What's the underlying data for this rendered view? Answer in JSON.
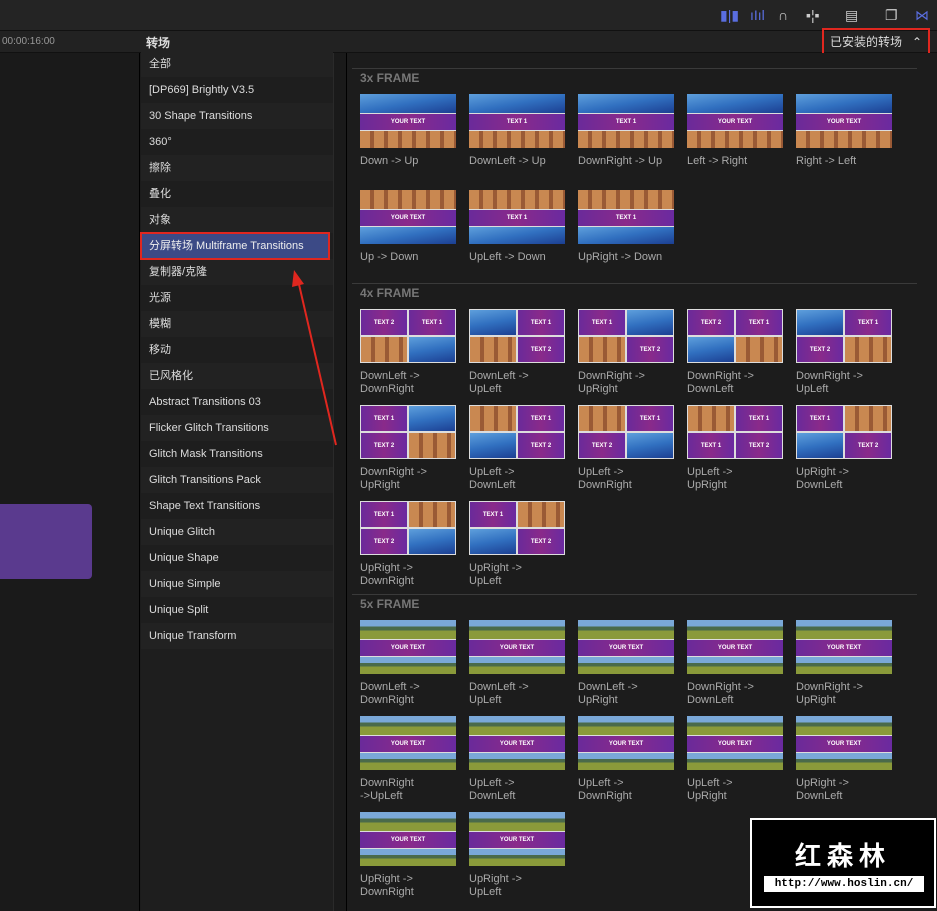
{
  "topbar": {
    "icons": [
      "clip-appearance-icon",
      "audio-waveform-icon",
      "headphones-icon",
      "snapping-icon",
      "filmstrip-icon",
      "window-icon",
      "transitions-browser-icon"
    ]
  },
  "timeline": {
    "timecode": "00:00:16:00"
  },
  "sidebar": {
    "title": "转场",
    "items": [
      "全部",
      "[DP669] Brightly V3.5",
      "30 Shape Transitions",
      "360°",
      "擦除",
      "叠化",
      "对象",
      "分屏转场 Multiframe Transitions",
      "复制器/克隆",
      "光源",
      "模糊",
      "移动",
      "已风格化",
      "Abstract Transitions 03",
      "Flicker Glitch Transitions",
      "Glitch Mask Transitions",
      "Glitch Transitions Pack",
      "Shape Text Transitions",
      "Unique Glitch",
      "Unique Shape",
      "Unique Simple",
      "Unique Split",
      "Unique Transform"
    ],
    "selected": 7
  },
  "filter": {
    "label": "已安装的转场",
    "icon": "chevron-updown-icon"
  },
  "sections": [
    {
      "title": "3x FRAME",
      "layout": "3x",
      "items": [
        {
          "label": "Down -> Up",
          "text": "YOUR TEXT",
          "v": "down"
        },
        {
          "label": "DownLeft -> Up",
          "text": "TEXT 1",
          "v": "dl"
        },
        {
          "label": "DownRight -> Up",
          "text": "TEXT 1",
          "v": "dr"
        },
        {
          "label": "Left -> Right",
          "text": "YOUR TEXT",
          "v": "l"
        },
        {
          "label": "Right -> Left",
          "text": "YOUR TEXT",
          "v": "r"
        },
        {
          "label": "Up -> Down",
          "text": "YOUR TEXT",
          "v": "up"
        },
        {
          "label": "UpLeft -> Down",
          "text": "TEXT 1",
          "v": "ul"
        },
        {
          "label": "UpRight -> Down",
          "text": "TEXT 1",
          "v": "ur"
        }
      ]
    },
    {
      "title": "4x FRAME",
      "layout": "4x",
      "items": [
        {
          "label": "DownLeft ->\nDownRight",
          "cells": [
            "TEXT 2",
            "TEXT 1",
            "forest",
            "blue"
          ]
        },
        {
          "label": "DownLeft ->\nUpLeft",
          "cells": [
            "blue",
            "TEXT 1",
            "forest",
            "TEXT 2"
          ]
        },
        {
          "label": "DownRight ->\nUpRight",
          "cells": [
            "TEXT 1",
            "blue",
            "forest",
            "TEXT 2"
          ]
        },
        {
          "label": "DownRight ->\nDownLeft",
          "cells": [
            "TEXT 2",
            "TEXT 1",
            "blue",
            "forest"
          ]
        },
        {
          "label": "DownRight ->\nUpLeft",
          "cells": [
            "blue",
            "TEXT 1",
            "TEXT 2",
            "forest"
          ]
        },
        {
          "label": "DownRight ->\nUpRight",
          "cells": [
            "TEXT 1",
            "blue",
            "TEXT 2",
            "forest"
          ]
        },
        {
          "label": "UpLeft ->\nDownLeft",
          "cells": [
            "forest",
            "TEXT 1",
            "blue",
            "TEXT 2"
          ]
        },
        {
          "label": "UpLeft ->\nDownRight",
          "cells": [
            "forest",
            "TEXT 1",
            "TEXT 2",
            "blue"
          ]
        },
        {
          "label": "UpLeft ->\nUpRight",
          "cells": [
            "forest",
            "TEXT 1",
            "TEXT 1",
            "TEXT 2"
          ]
        },
        {
          "label": "UpRight ->\nDownLeft",
          "cells": [
            "TEXT 1",
            "forest",
            "blue",
            "TEXT 2"
          ]
        },
        {
          "label": "UpRight ->\nDownRight",
          "cells": [
            "TEXT 1",
            "forest",
            "TEXT 2",
            "blue"
          ]
        },
        {
          "label": "UpRight ->\nUpLeft",
          "cells": [
            "TEXT 1",
            "forest",
            "blue",
            "TEXT 2"
          ]
        }
      ]
    },
    {
      "title": "5x FRAME",
      "layout": "5x",
      "items": [
        {
          "label": "DownLeft ->\nDownRight",
          "text": "YOUR TEXT"
        },
        {
          "label": "DownLeft ->\nUpLeft",
          "text": "YOUR TEXT"
        },
        {
          "label": "DownLeft ->\nUpRight",
          "text": "YOUR TEXT"
        },
        {
          "label": "DownRight ->\nDownLeft",
          "text": "YOUR TEXT"
        },
        {
          "label": "DownRight ->\nUpRight",
          "text": "YOUR TEXT"
        },
        {
          "label": "DownRight\n->UpLeft",
          "text": "YOUR TEXT"
        },
        {
          "label": "UpLeft ->\nDownLeft",
          "text": "YOUR TEXT"
        },
        {
          "label": "UpLeft ->\nDownRight",
          "text": "YOUR TEXT"
        },
        {
          "label": "UpLeft ->\nUpRight",
          "text": "YOUR TEXT"
        },
        {
          "label": "UpRight ->\nDownLeft",
          "text": "YOUR TEXT"
        },
        {
          "label": "UpRight ->\nDownRight",
          "text": "YOUR TEXT"
        },
        {
          "label": "UpRight ->\nUpLeft",
          "text": "YOUR TEXT"
        }
      ]
    }
  ],
  "watermark": {
    "title": "红森林",
    "url": "http://www.hoslin.cn/"
  },
  "colors": {
    "highlight": "#e0271f",
    "selection": "#3c4a86",
    "accent": "#5a6ee0"
  }
}
